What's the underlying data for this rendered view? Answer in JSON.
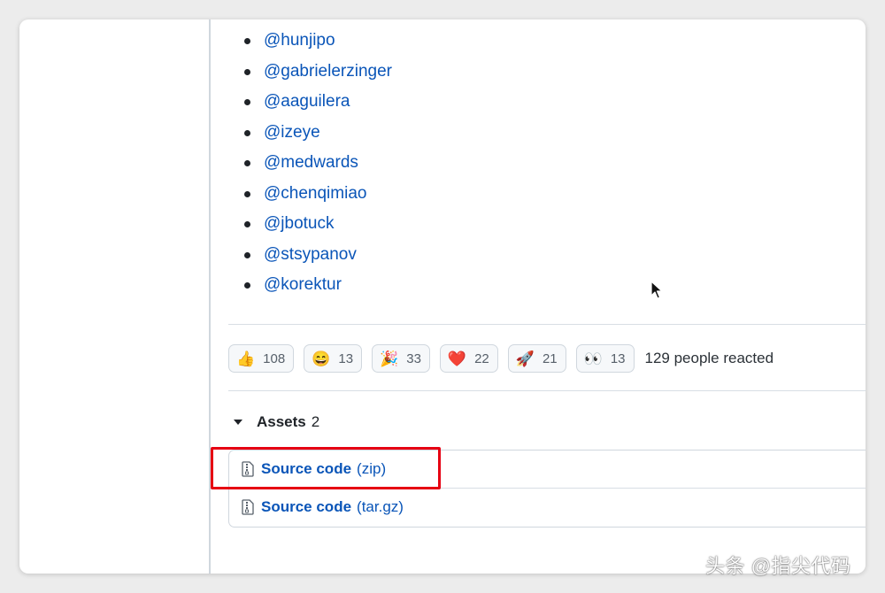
{
  "contributors": [
    "@hunjipo",
    "@gabrielerzinger",
    "@aaguilera",
    "@izeye",
    "@medwards",
    "@chenqimiao",
    "@jbotuck",
    "@stsypanov",
    "@korektur"
  ],
  "reactions": [
    {
      "emoji": "👍",
      "icon": "thumbs-up-icon",
      "count": "108"
    },
    {
      "emoji": "😄",
      "icon": "smile-icon",
      "count": "13"
    },
    {
      "emoji": "🎉",
      "icon": "party-popper-icon",
      "count": "33"
    },
    {
      "emoji": "❤️",
      "icon": "heart-icon",
      "count": "22"
    },
    {
      "emoji": "🚀",
      "icon": "rocket-icon",
      "count": "21"
    },
    {
      "emoji": "👀",
      "icon": "eyes-icon",
      "count": "13"
    }
  ],
  "reaction_summary": "129 people reacted",
  "assets": {
    "title": "Assets",
    "count": "2",
    "items": [
      {
        "name": "Source code",
        "ext": "(zip)"
      },
      {
        "name": "Source code",
        "ext": "(tar.gz)"
      }
    ]
  },
  "watermark": "头条 @指尖代码",
  "colors": {
    "link": "#0a55b8",
    "highlight": "#e60012",
    "border": "#d0d7de"
  }
}
